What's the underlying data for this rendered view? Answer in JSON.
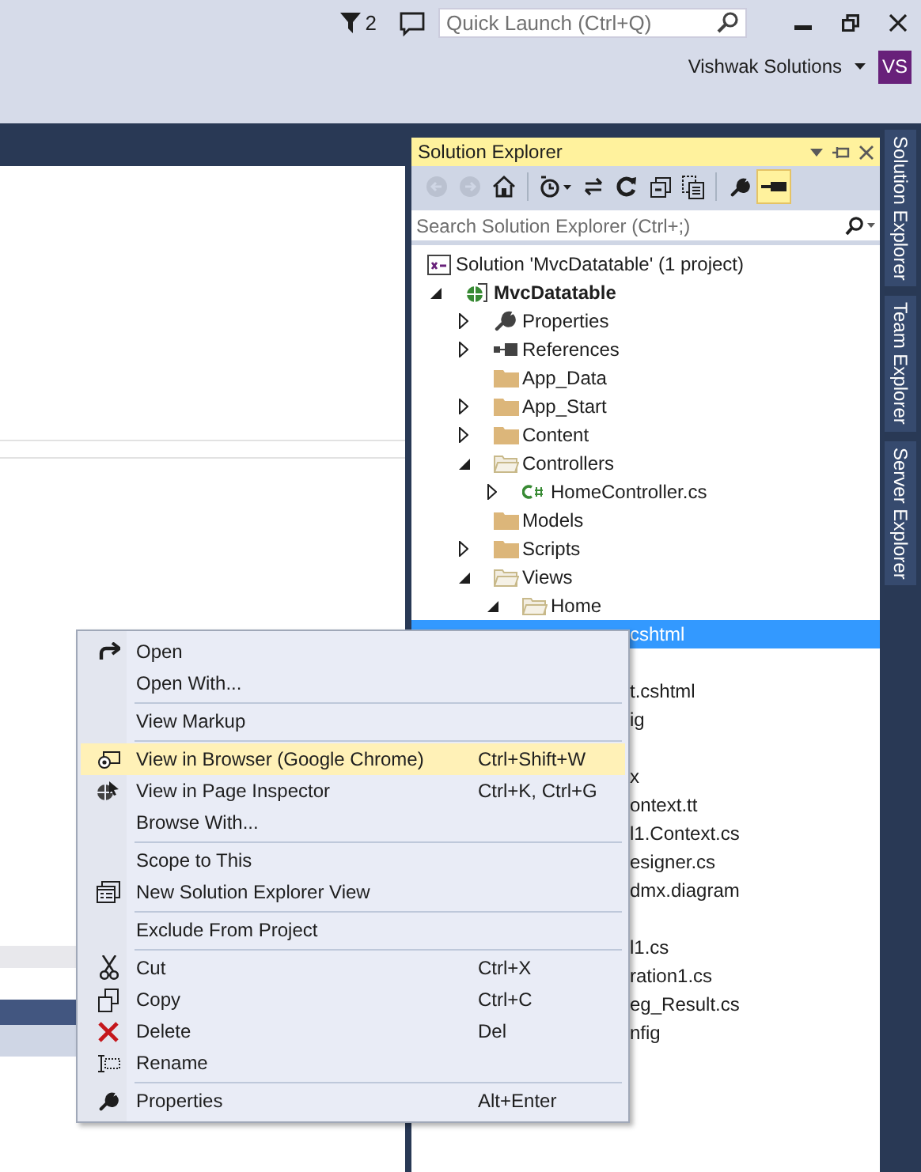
{
  "title_bar": {
    "notifications_count": "2",
    "quick_launch": {
      "placeholder": "Quick Launch (Ctrl+Q)"
    },
    "account_name": "Vishwak Solutions",
    "account_badge": "VS"
  },
  "solution_explorer": {
    "title": "Solution Explorer",
    "toolbar": [
      {
        "kind": "back",
        "disabled": true,
        "pressed": false
      },
      {
        "kind": "forward",
        "disabled": true,
        "pressed": false
      },
      {
        "kind": "home",
        "disabled": false,
        "pressed": false
      },
      {
        "kind": "history",
        "disabled": false,
        "pressed": false
      },
      {
        "kind": "sync",
        "disabled": false,
        "pressed": false
      },
      {
        "kind": "refresh",
        "disabled": false,
        "pressed": false
      },
      {
        "kind": "collapse",
        "disabled": false,
        "pressed": false
      },
      {
        "kind": "show-files",
        "disabled": false,
        "pressed": false
      },
      {
        "kind": "properties",
        "disabled": false,
        "pressed": false
      },
      {
        "kind": "preview",
        "disabled": false,
        "pressed": true
      }
    ],
    "search": {
      "placeholder": "Search Solution Explorer (Ctrl+;)"
    },
    "tree": [
      {
        "label": "Solution 'MvcDatatable' (1 project)",
        "kind": "solution",
        "children": [
          {
            "label": "MvcDatatable",
            "kind": "project",
            "expanded": true,
            "children": [
              {
                "label": "Properties",
                "kind": "wrench",
                "expanded": false
              },
              {
                "label": "References",
                "kind": "references",
                "expanded": false
              },
              {
                "label": "App_Data",
                "kind": "folder"
              },
              {
                "label": "App_Start",
                "kind": "folder",
                "expanded": false
              },
              {
                "label": "Content",
                "kind": "folder",
                "expanded": false
              },
              {
                "label": "Controllers",
                "kind": "folder",
                "expanded": true,
                "children": [
                  {
                    "label": "HomeController.cs",
                    "kind": "csharp",
                    "expanded": false
                  }
                ]
              },
              {
                "label": "Models",
                "kind": "folder"
              },
              {
                "label": "Scripts",
                "kind": "folder",
                "expanded": false
              },
              {
                "label": "Views",
                "kind": "folder",
                "expanded": true,
                "children": [
                  {
                    "label": "Home",
                    "kind": "folder",
                    "expanded": true
                  }
                ]
              }
            ]
          }
        ]
      }
    ],
    "hidden_rows": [
      {
        "text": "cshtml",
        "selected": true
      },
      {
        "selected": false
      },
      {
        "text": "t.cshtml",
        "selected": false
      },
      {
        "text": "ig",
        "selected": false
      },
      {
        "selected": false
      },
      {
        "text": "x",
        "selected": false
      },
      {
        "text": "ontext.tt",
        "selected": false
      },
      {
        "text": "l1.Context.cs",
        "selected": false
      },
      {
        "text": "esigner.cs",
        "selected": false
      },
      {
        "text": "dmx.diagram",
        "selected": false
      },
      {
        "selected": false
      },
      {
        "text": "l1.cs",
        "selected": false
      },
      {
        "text": "ration1.cs",
        "selected": false
      },
      {
        "text": "eg_Result.cs",
        "selected": false
      },
      {
        "text": "nfig",
        "selected": false
      }
    ]
  },
  "side_tabs": [
    {
      "label": "Solution Explorer"
    },
    {
      "label": "Team Explorer"
    },
    {
      "label": "Server Explorer"
    }
  ],
  "context_menu": {
    "groups": [
      [
        {
          "label": "Open",
          "kind": "open",
          "selected": false
        },
        {
          "label": "Open With...",
          "selected": false
        }
      ],
      [
        {
          "label": "View Markup",
          "selected": false
        }
      ],
      [
        {
          "label": "View in Browser (Google Chrome)",
          "shortcut": "Ctrl+Shift+W",
          "kind": "browser",
          "selected": true
        },
        {
          "label": "View in Page Inspector",
          "shortcut": "Ctrl+K, Ctrl+G",
          "kind": "inspector",
          "selected": false
        },
        {
          "label": "Browse With...",
          "selected": false
        }
      ],
      [
        {
          "label": "Scope to This",
          "selected": false
        },
        {
          "label": "New Solution Explorer View",
          "kind": "new-view",
          "selected": false
        }
      ],
      [
        {
          "label": "Exclude From Project",
          "selected": false
        }
      ],
      [
        {
          "label": "Cut",
          "shortcut": "Ctrl+X",
          "kind": "cut",
          "selected": false
        },
        {
          "label": "Copy",
          "shortcut": "Ctrl+C",
          "kind": "copy",
          "selected": false
        },
        {
          "label": "Delete",
          "shortcut": "Del",
          "kind": "delete",
          "selected": false
        },
        {
          "label": "Rename",
          "kind": "rename",
          "selected": false
        }
      ],
      [
        {
          "label": "Properties",
          "shortcut": "Alt+Enter",
          "kind": "properties",
          "selected": false
        }
      ]
    ]
  }
}
